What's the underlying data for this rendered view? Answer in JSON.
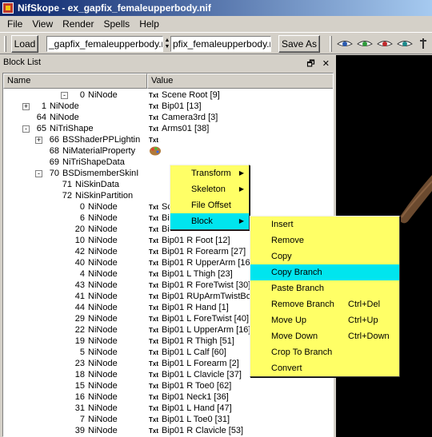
{
  "window": {
    "title": "NifSkope - ex_gapfix_femaleupperbody.nif"
  },
  "menu": [
    "File",
    "View",
    "Render",
    "Spells",
    "Help"
  ],
  "toolbar": {
    "load_label": "Load",
    "load_path": "_gapfix_femaleupperbody.nif",
    "save_path": "pfix_femaleupperbody.nif",
    "save_label": "Save As"
  },
  "dock": {
    "title": "Block List",
    "float_glyph": "🗗",
    "close_glyph": "✕"
  },
  "columns": {
    "name": "Name",
    "value": "Value"
  },
  "tree_rows": [
    {
      "exp": "-",
      "num": "0",
      "name": "NiNode",
      "txt": "Txt",
      "value": "Scene Root [9]"
    },
    {
      "exp": "+",
      "num": "1",
      "name": "NiNode",
      "txt": "Txt",
      "value": "Bip01 [13]"
    },
    {
      "exp": "",
      "num": "64",
      "name": "NiNode",
      "txt": "Txt",
      "value": "Camera3rd [3]"
    },
    {
      "exp": "-",
      "num": "65",
      "name": "NiTriShape",
      "txt": "Txt",
      "value": "Arms01 [38]"
    },
    {
      "exp": "+",
      "num": "66",
      "name": "BSShaderPPLightin",
      "txt": "Txt",
      "value": ""
    },
    {
      "exp": "",
      "num": "68",
      "name": "NiMaterialProperty",
      "txt": "",
      "value": ""
    },
    {
      "exp": "",
      "num": "69",
      "name": "NiTriShapeData",
      "txt": "",
      "value": ""
    },
    {
      "exp": "-",
      "num": "70",
      "name": "BSDismemberSkinI",
      "txt": "",
      "value": ""
    },
    {
      "exp": "",
      "num": "71",
      "name": "NiSkinData",
      "txt": "",
      "value": "",
      "selected": true
    },
    {
      "exp": "",
      "num": "72",
      "name": "NiSkinPartition",
      "txt": "",
      "value": ""
    },
    {
      "exp": "",
      "num": "0",
      "name": "NiNode",
      "txt": "Txt",
      "value": "Sc"
    },
    {
      "exp": "",
      "num": "6",
      "name": "NiNode",
      "txt": "Txt",
      "value": "Bi"
    },
    {
      "exp": "",
      "num": "20",
      "name": "NiNode",
      "txt": "Txt",
      "value": "Bi"
    },
    {
      "exp": "",
      "num": "10",
      "name": "NiNode",
      "txt": "Txt",
      "value": "Bip01 R Foot [12]"
    },
    {
      "exp": "",
      "num": "42",
      "name": "NiNode",
      "txt": "Txt",
      "value": "Bip01 R Forearm [27]"
    },
    {
      "exp": "",
      "num": "40",
      "name": "NiNode",
      "txt": "Txt",
      "value": "Bip01 R UpperArm [16]"
    },
    {
      "exp": "",
      "num": "4",
      "name": "NiNode",
      "txt": "Txt",
      "value": "Bip01 L Thigh [23]"
    },
    {
      "exp": "",
      "num": "43",
      "name": "NiNode",
      "txt": "Txt",
      "value": "Bip01 R ForeTwist [30]"
    },
    {
      "exp": "",
      "num": "41",
      "name": "NiNode",
      "txt": "Txt",
      "value": "Bip01 RUpArmTwistBo"
    },
    {
      "exp": "",
      "num": "44",
      "name": "NiNode",
      "txt": "Txt",
      "value": "Bip01 R Hand [1]"
    },
    {
      "exp": "",
      "num": "29",
      "name": "NiNode",
      "txt": "Txt",
      "value": "Bip01 L ForeTwist [40]"
    },
    {
      "exp": "",
      "num": "22",
      "name": "NiNode",
      "txt": "Txt",
      "value": "Bip01 L UpperArm [16]"
    },
    {
      "exp": "",
      "num": "19",
      "name": "NiNode",
      "txt": "Txt",
      "value": "Bip01 R Thigh [51]"
    },
    {
      "exp": "",
      "num": "5",
      "name": "NiNode",
      "txt": "Txt",
      "value": "Bip01 L Calf [60]"
    },
    {
      "exp": "",
      "num": "23",
      "name": "NiNode",
      "txt": "Txt",
      "value": "Bip01 L Forearm [2]"
    },
    {
      "exp": "",
      "num": "18",
      "name": "NiNode",
      "txt": "Txt",
      "value": "Bip01 L Clavicle [37]"
    },
    {
      "exp": "",
      "num": "15",
      "name": "NiNode",
      "txt": "Txt",
      "value": "Bip01 R Toe0 [62]"
    },
    {
      "exp": "",
      "num": "16",
      "name": "NiNode",
      "txt": "Txt",
      "value": "Bip01 Neck1 [36]"
    },
    {
      "exp": "",
      "num": "31",
      "name": "NiNode",
      "txt": "Txt",
      "value": "Bip01 L Hand [47]"
    },
    {
      "exp": "",
      "num": "7",
      "name": "NiNode",
      "txt": "Txt",
      "value": "Bip01 L Toe0 [31]"
    },
    {
      "exp": "",
      "num": "39",
      "name": "NiNode",
      "txt": "Txt",
      "value": "Bip01 R Clavicle [53]"
    }
  ],
  "context_menu": [
    {
      "label": "Transform",
      "sub": true
    },
    {
      "label": "Skeleton",
      "sub": true
    },
    {
      "label": "File Offset",
      "sub": false
    },
    {
      "label": "Block",
      "sub": true,
      "active": true
    }
  ],
  "block_menu": [
    {
      "label": "Insert",
      "shortcut": ""
    },
    {
      "label": "Remove",
      "shortcut": ""
    },
    {
      "label": "Copy",
      "shortcut": ""
    },
    {
      "label": "Copy Branch",
      "shortcut": "",
      "active": true
    },
    {
      "label": "Paste Branch",
      "shortcut": ""
    },
    {
      "label": "Remove Branch",
      "shortcut": "Ctrl+Del"
    },
    {
      "label": "Move Up",
      "shortcut": "Ctrl+Up"
    },
    {
      "label": "Move Down",
      "shortcut": "Ctrl+Down"
    },
    {
      "label": "Crop To Branch",
      "shortcut": ""
    },
    {
      "label": "Convert",
      "shortcut": ""
    }
  ],
  "colors": {
    "menu_bg": "#ffff66",
    "menu_highlight": "#00e5ee",
    "selection": "#316ac5",
    "title_start": "#0a246a"
  }
}
